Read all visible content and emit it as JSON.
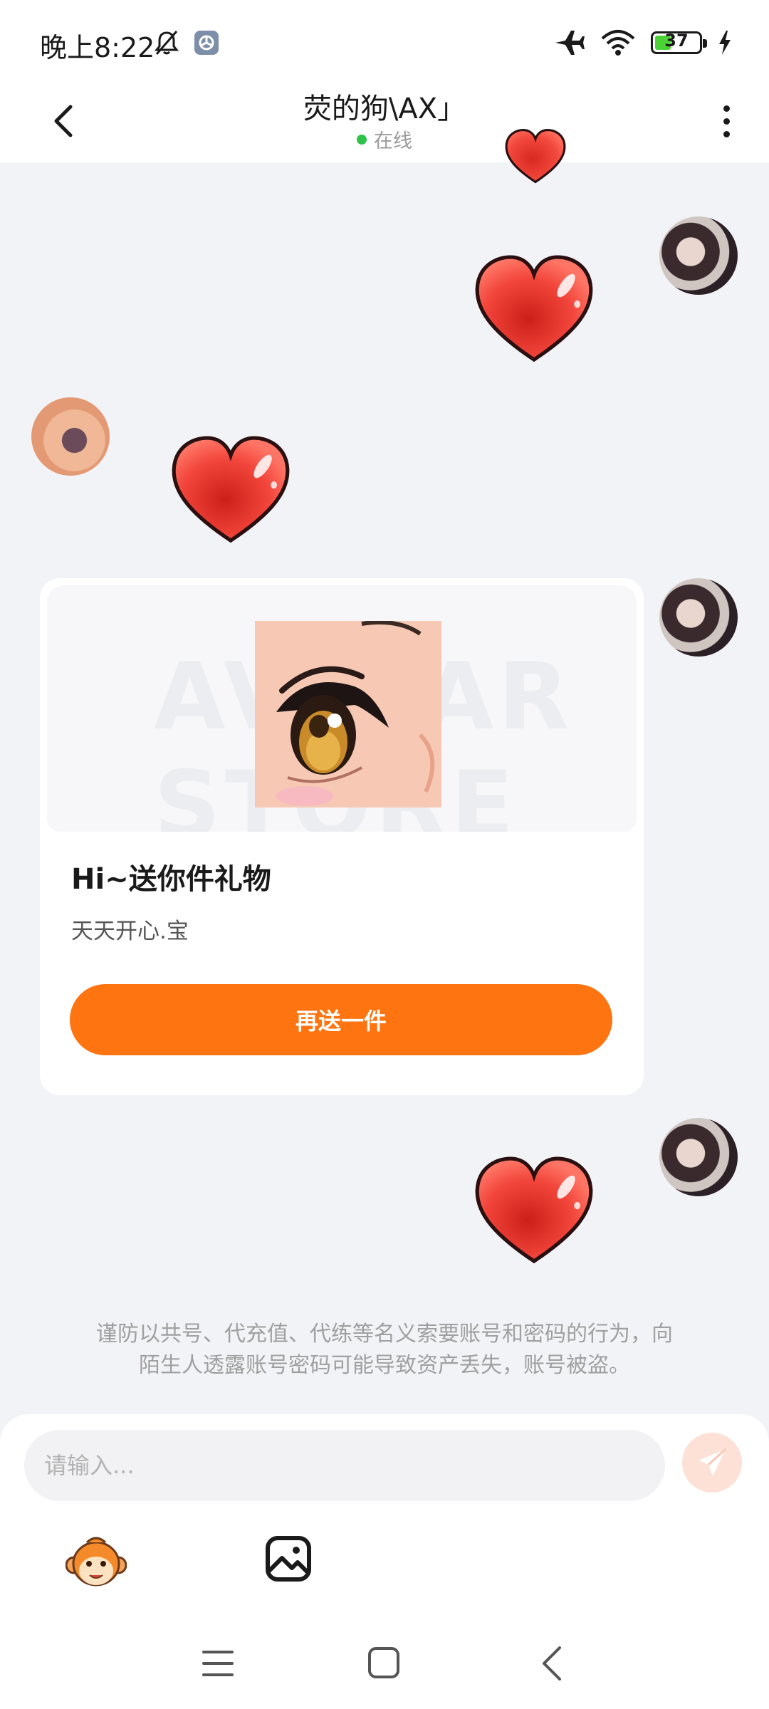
{
  "status_bar": {
    "time": "晚上8:22",
    "battery_level": "37",
    "battery_fraction": 0.37,
    "icons": [
      "mute-icon",
      "app-notification-icon",
      "airplane-icon",
      "wifi-icon",
      "battery-icon",
      "charging-icon"
    ]
  },
  "header": {
    "title": "荧的狗\\AX」",
    "status": "在线",
    "status_color": "#2ec24a"
  },
  "messages": [
    {
      "from": "me",
      "type": "heart-sticker"
    },
    {
      "from": "other",
      "type": "heart-sticker"
    },
    {
      "from": "me",
      "type": "gift-card"
    },
    {
      "from": "me",
      "type": "heart-sticker"
    }
  ],
  "gift_card": {
    "watermark": "AVATAR STORE",
    "title": "Hi~送你件礼物",
    "message": "天天开心.宝",
    "button_label": "再送一件",
    "button_color": "#fd7411"
  },
  "safety_notice": {
    "line1": "谨防以共号、代充值、代练等名义索要账号和密码的行为，向",
    "line2": "陌生人透露账号密码可能导致资产丢失，账号被盗。"
  },
  "input_bar": {
    "placeholder": "请输入..."
  },
  "colors": {
    "accent": "#fd7411",
    "heart": "#f03a33",
    "background": "#f2f3f7"
  }
}
